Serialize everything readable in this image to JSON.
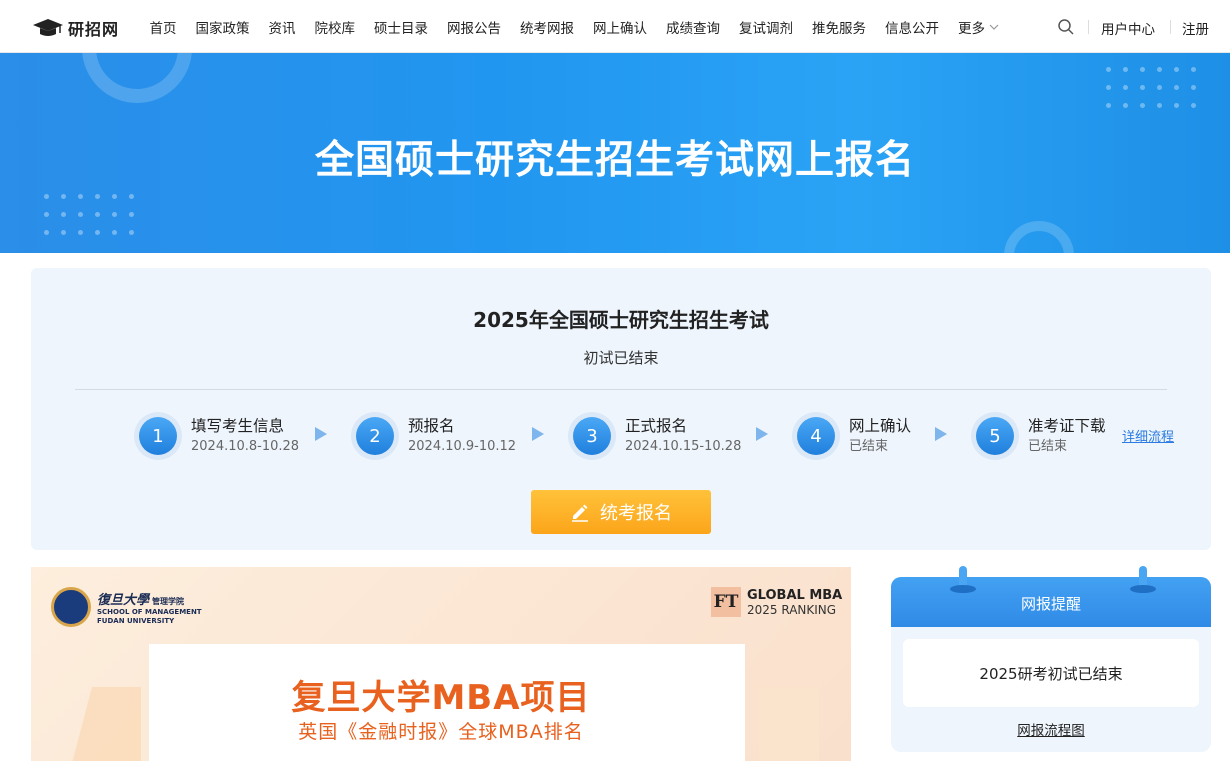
{
  "header": {
    "logo_text": "研招网",
    "nav": [
      "首页",
      "国家政策",
      "资讯",
      "院校库",
      "硕士目录",
      "网报公告",
      "统考网报",
      "网上确认",
      "成绩查询",
      "复试调剂",
      "推免服务",
      "信息公开"
    ],
    "more_label": "更多",
    "user_center": "用户中心",
    "register": "注册"
  },
  "banner": {
    "title": "全国硕士研究生招生考试网上报名"
  },
  "registration": {
    "title": "2025年全国硕士研究生招生考试",
    "status": "初试已结束",
    "steps": [
      {
        "num": "1",
        "name": "填写考生信息",
        "date": "2024.10.8-10.28"
      },
      {
        "num": "2",
        "name": "预报名",
        "date": "2024.10.9-10.12"
      },
      {
        "num": "3",
        "name": "正式报名",
        "date": "2024.10.15-10.28"
      },
      {
        "num": "4",
        "name": "网上确认",
        "date": "已结束"
      },
      {
        "num": "5",
        "name": "准考证下载",
        "date": "已结束"
      }
    ],
    "detail_link": "详细流程",
    "button_label": "统考报名"
  },
  "ad": {
    "school_cn": "復旦大學",
    "school_cn_sub": "管理学院",
    "school_en_1": "SCHOOL OF MANAGEMENT",
    "school_en_2": "FUDAN UNIVERSITY",
    "ft_logo": "FT",
    "ft_line1": "GLOBAL MBA",
    "ft_line2": "2025 RANKING",
    "title": "复旦大学MBA项目",
    "subtitle": "英国《金融时报》全球MBA排名"
  },
  "reminder": {
    "title": "网报提醒",
    "message": "2025研考初试已结束",
    "link": "网报流程图"
  },
  "colors": {
    "primary_blue": "#2196f0",
    "accent_orange": "#fca51a",
    "ad_orange": "#e8611e"
  }
}
